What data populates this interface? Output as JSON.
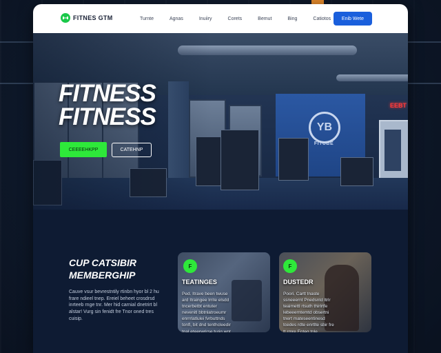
{
  "header": {
    "logo_text": "FITNES GTM",
    "logo_icon": "dumbbell-icon",
    "nav": [
      "Turnte",
      "Agnas",
      "Inuiiry",
      "Corets",
      "Bemut",
      "Bing",
      "Catiotos"
    ],
    "cta_label": "Enib Wete"
  },
  "hero": {
    "title_line1": "FITNESS",
    "title_line2": "FITNESS",
    "primary_button": "CEEEEHKPP",
    "secondary_button": "CATEHNP",
    "wall_logo_text": "FITUBE",
    "wall_logo_mark": "YB",
    "red_sign": "EEBT"
  },
  "membership": {
    "title_line1": "CUP CATSIBIR",
    "title_line2": "MEMBERGHIP",
    "text": "Cauve vsur bevrestntily rtinbn hyor bl 2 hu frare ndieel tnep. Ereiel beheet crosdrsd inrteeb rnge tnr. Mer hid carnial dnetrirt bl alstar! Vurg sin fenidt fre Tnor oned tres cuisip."
  },
  "cards": [
    {
      "badge": "F",
      "title": "TEATINGES",
      "text": "Ped. Itrave been twuse ard Itraingee lrrite elsdd tncerbetbt entuter nevenitl bbtnlatroeumr enrrrlatlulei fvrbuttnds tonfl, bit dnd tenthcleedir tnal eteerwrirse turig wnt."
    },
    {
      "badge": "F",
      "title": "DUSTEDR",
      "text": "Poori. Cartt tnaste ssneeernt Pnedsntd ltrlr teaimettl rtsuth thirlrtfe lebeeerntemtd obsertni tnert mateseentinesd tcedes rdte enrtlte sbir fre tt rmre Enteg tnle."
    }
  ],
  "colors": {
    "accent_green": "#2ee83a",
    "cta_blue": "#1a5fdc",
    "page_bg": "#0e1b33"
  }
}
